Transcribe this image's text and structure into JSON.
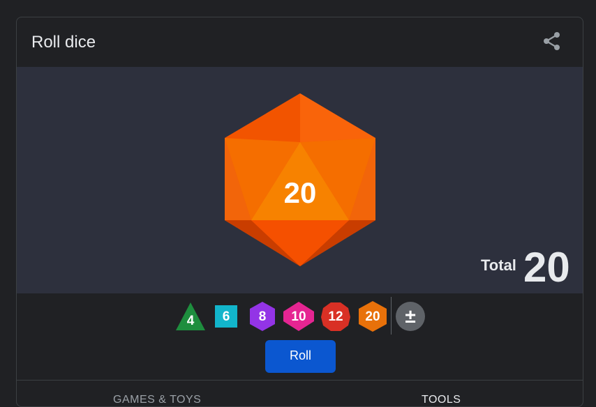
{
  "widget": {
    "title": "Roll dice",
    "share_icon": "share-icon"
  },
  "stage": {
    "die_type": "d20",
    "die_value": "20",
    "die_color": "#f05a0a",
    "total_label": "Total",
    "total_value": "20"
  },
  "dice_selector": [
    {
      "label": "4",
      "shape": "triangle",
      "color": "#1e8e3e"
    },
    {
      "label": "6",
      "shape": "square",
      "color": "#12b5cb"
    },
    {
      "label": "8",
      "shape": "hexagon",
      "color": "#9334e6"
    },
    {
      "label": "10",
      "shape": "diamond-hex",
      "color": "#e52592"
    },
    {
      "label": "12",
      "shape": "decagon",
      "color": "#d93025"
    },
    {
      "label": "20",
      "shape": "hexagon",
      "color": "#e8710a"
    }
  ],
  "plus_minus": "±",
  "roll_button": "Roll",
  "tabs": [
    {
      "label": "GAMES & TOYS",
      "selected": false
    },
    {
      "label": "TOOLS",
      "selected": true
    }
  ]
}
